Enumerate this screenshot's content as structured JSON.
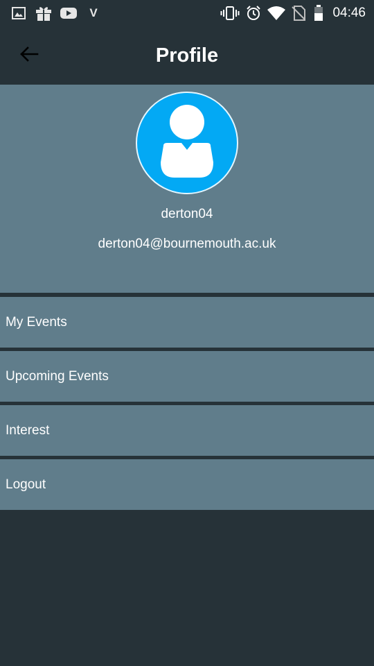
{
  "status_bar": {
    "time": "04:46",
    "carrier_glyph": "V",
    "left_icons": [
      "gallery-icon",
      "gift-icon",
      "youtube-icon",
      "v-icon"
    ],
    "right_icons": [
      "vibrate-icon",
      "alarm-icon",
      "wifi-icon",
      "no-sim-icon",
      "battery-icon"
    ]
  },
  "header": {
    "title": "Profile",
    "back_icon": "arrow-left-icon"
  },
  "profile": {
    "username": "derton04",
    "email": "derton04@bournemouth.ac.uk",
    "avatar_icon": "user-avatar-icon"
  },
  "menu": {
    "items": [
      {
        "label": "My Events"
      },
      {
        "label": "Upcoming Events"
      },
      {
        "label": "Interest"
      },
      {
        "label": "Logout"
      }
    ]
  },
  "colors": {
    "background": "#263238",
    "panel": "#607d8b",
    "avatar": "#03a9f4",
    "text": "#ffffff"
  }
}
